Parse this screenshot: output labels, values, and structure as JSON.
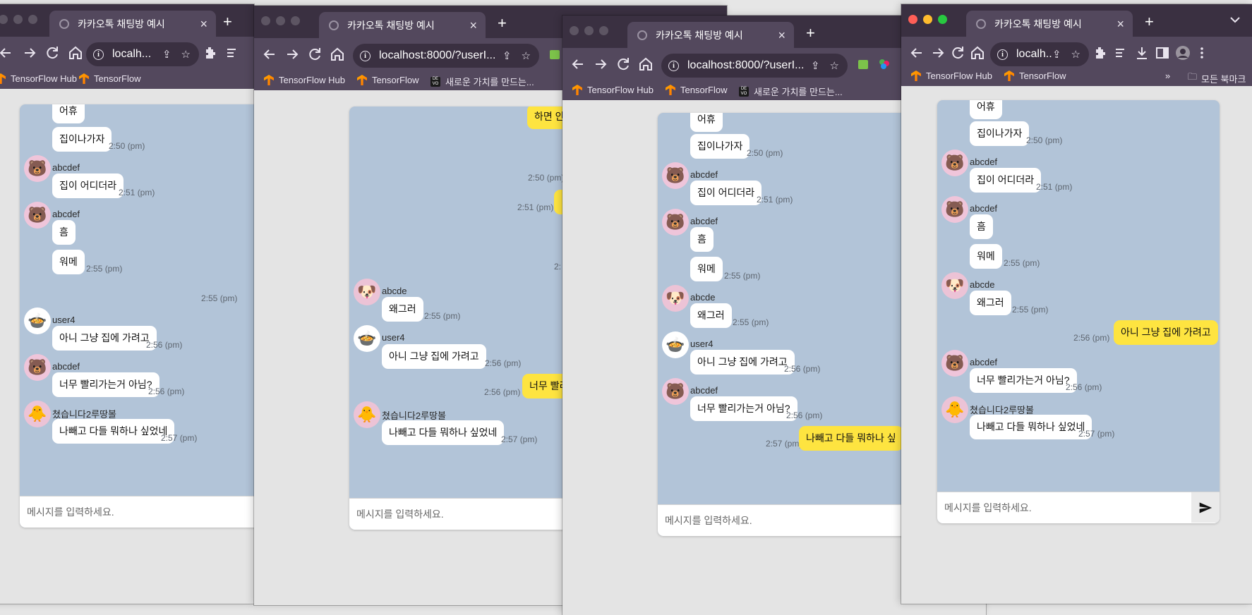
{
  "browser": {
    "tab_title": "카카오톡 채팅방 예시",
    "url_truncated": "localh...",
    "url_full": "localhost:8000/?userI...",
    "bookmarks": [
      "TensorFlow Hub",
      "TensorFlow",
      "새로운 가치를 만드는..."
    ],
    "all_bookmarks_label": "모든 북마크",
    "overflow_label": "»"
  },
  "chat": {
    "input_placeholder": "메시지를 입력하세요.",
    "users": [
      "abcdef",
      "abcde",
      "user4",
      "쳤습니다2루땅볼"
    ],
    "messages": {
      "m1": {
        "text": "어휴"
      },
      "m2": {
        "text": "집이나가자",
        "time": "2:50 (pm)"
      },
      "m3": {
        "sender": "abcdef",
        "text": "집이 어디더라",
        "time": "2:51 (pm)"
      },
      "m4": {
        "sender": "abcdef",
        "text": "흠"
      },
      "m5": {
        "text": "워메",
        "time": "2:55 (pm)"
      },
      "m6": {
        "sender": "abcde",
        "text": "왜그러",
        "time": "2:55 (pm)"
      },
      "m7": {
        "sender": "user4",
        "text": "아니 그냥 집에 가려고",
        "time": "2:56 (pm)"
      },
      "m8": {
        "text": "아니 그냥 집에 가려고",
        "time": "2:56 (pm)"
      },
      "m9": {
        "sender": "abcdef",
        "text": "너무 빨리가는거 아님?",
        "time": "2:56 (pm)"
      },
      "m10": {
        "sender": "쳤습니다2루땅볼",
        "text": "나빼고 다들 뭐하나 싶었네",
        "time": "2:57 (pm)"
      },
      "m11": {
        "text": "나빼고 다들 뭐하나 싶었네",
        "time": "2:57 (pm)"
      }
    },
    "win2_extra": {
      "top_bubble": "하면 안",
      "time_250": "2:50 (pm)",
      "time_251": "2:51 (pm)",
      "time_cut": "2:",
      "mine_cut": "너무 빨리",
      "mine_time": "2:56 (pm)"
    },
    "win1_extra": {
      "lone_time": "2:55 (pm)"
    },
    "win3_extra": {
      "mine_cut": "나빼고 다들 뭐하나 싶",
      "mine_time": "2:57 (pm)"
    }
  }
}
